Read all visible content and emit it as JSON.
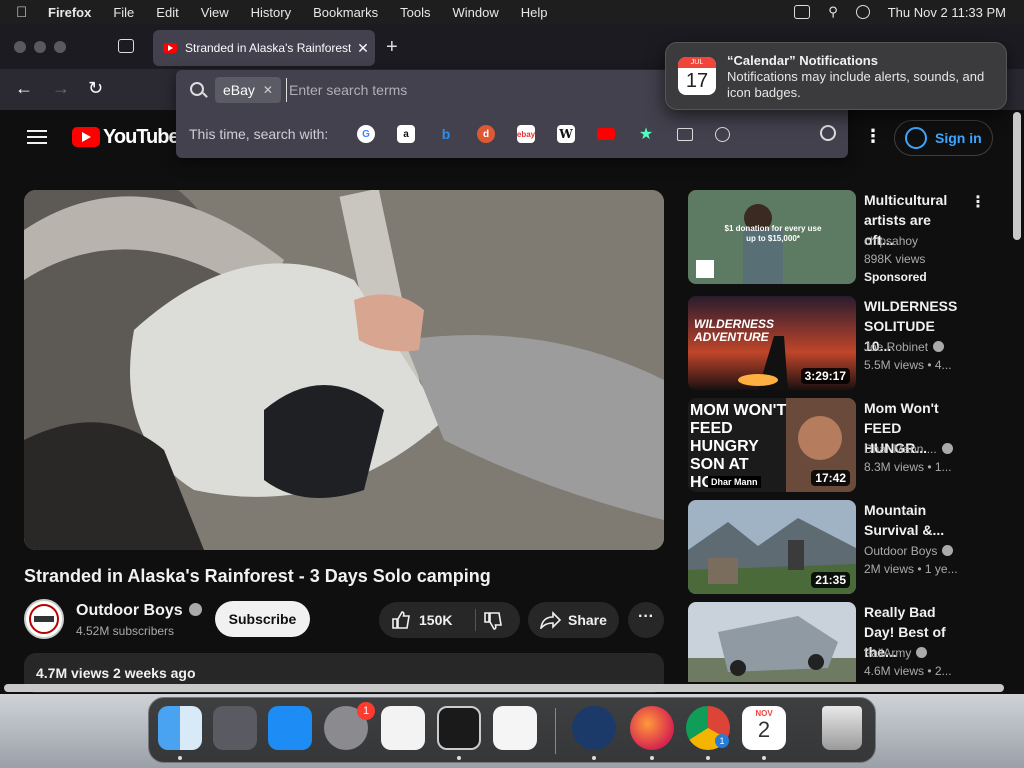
{
  "menubar": {
    "app": "Firefox",
    "items": [
      "File",
      "Edit",
      "View",
      "History",
      "Bookmarks",
      "Tools",
      "Window",
      "Help"
    ],
    "datetime": "Thu Nov 2  11:33 PM"
  },
  "tab": {
    "title": "Stranded in Alaska's Rainforest"
  },
  "urlbar": {
    "engine_chip": "eBay",
    "placeholder": "Enter search terms",
    "oneoff_label": "This time, search with:"
  },
  "notification": {
    "title": "“Calendar” Notifications",
    "body": "Notifications may include alerts, sounds, and icon badges.",
    "icon_month": "JUL",
    "icon_day": "17"
  },
  "youtube": {
    "logo_text": "YouTube",
    "signin": "Sign in"
  },
  "video": {
    "title": "Stranded in Alaska's Rainforest - 3 Days Solo camping",
    "channel": "Outdoor Boys",
    "subscribers": "4.52M subscribers",
    "subscribe": "Subscribe",
    "likes": "150K",
    "share": "Share",
    "views": "4.7M views  2 weeks ago"
  },
  "recommendations": [
    {
      "title": "Multicultural artists are oft...",
      "channel": "chipsahoy",
      "views": "898K views",
      "sponsored": "Sponsored",
      "thumb_text": "$1 donation for every use up to $15,000*"
    },
    {
      "title": "WILDERNESS SOLITUDE 10...",
      "channel": "Joe Robinet",
      "views": "5.5M views  • 4...",
      "duration": "3:29:17",
      "thumb_text": "WILDERNESS ADVENTURE"
    },
    {
      "title": "Mom Won't FEED HUNGR...",
      "channel": "Dhar Mann ...",
      "views": "8.3M views  • 1...",
      "duration": "17:42",
      "thumb_text": "MOM WON'T FEED HUNGRY SON AT HOME",
      "thumb_tag": "Dhar Mann"
    },
    {
      "title": "Mountain Survival &...",
      "channel": "Outdoor Boys",
      "views": "2M views  • 1 ye...",
      "duration": "21:35"
    },
    {
      "title": "Really Bad Day! Best of the...",
      "channel": "FailArmy",
      "views": "4.6M views  • 2..."
    }
  ],
  "dock": {
    "settings_badge": "1",
    "calendar_month": "NOV",
    "calendar_day": "2",
    "chrome_badge": "1"
  }
}
